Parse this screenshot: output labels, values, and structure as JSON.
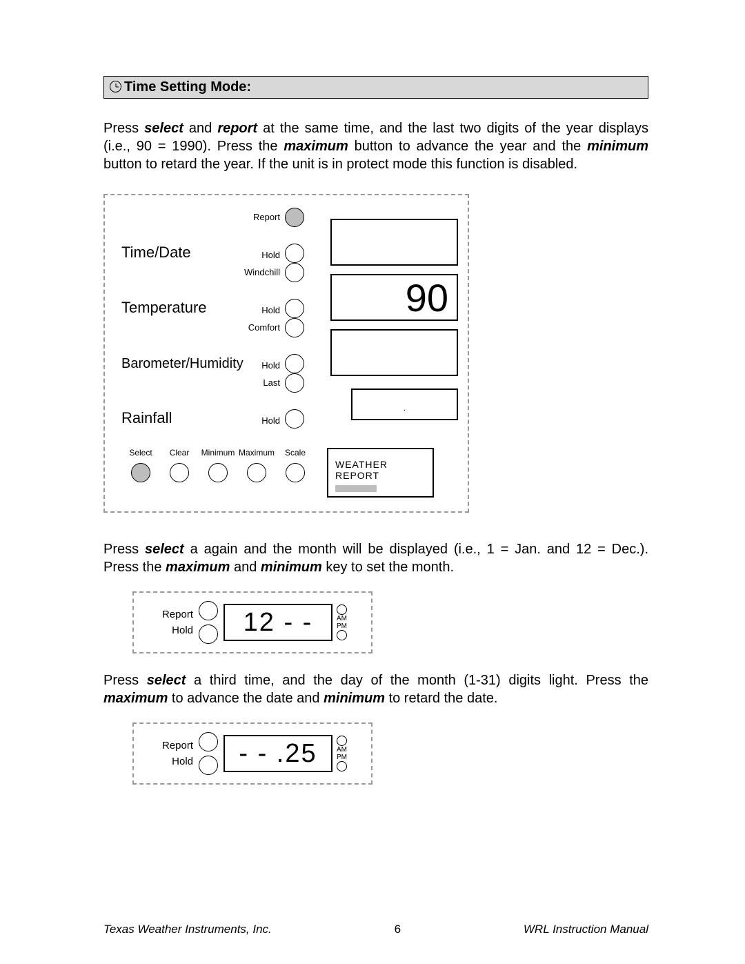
{
  "heading": "Time Setting Mode:",
  "para1": {
    "a": "Press ",
    "b": " and ",
    "c": " at the same time, and the last two digits of the year displays (i.e., 90 = 1990). Press the ",
    "d": " button to advance the year and the ",
    "e": " button to retard the year.  If the unit is in protect mode this function is disabled.",
    "select": "select",
    "report": "report",
    "maximum": "maximum",
    "minimum": "minimum"
  },
  "device": {
    "rows": [
      {
        "title": "Time/Date",
        "topLabel": "Report",
        "botLabel": "Hold",
        "topFilled": true,
        "display": ""
      },
      {
        "title": "Temperature",
        "topLabel": "Windchill",
        "botLabel": "Hold",
        "topFilled": false,
        "display": "90"
      },
      {
        "title": "Barometer/Humidity",
        "topLabel": "Comfort",
        "botLabel": "Hold",
        "topFilled": false,
        "display": ""
      },
      {
        "title": "Rainfall",
        "topLabel": "Last",
        "botLabel": "Hold",
        "topFilled": false,
        "display": "."
      }
    ],
    "bottomButtons": [
      "Select",
      "Clear",
      "Minimum",
      "Maximum",
      "Scale"
    ],
    "bottomFilled": [
      true,
      false,
      false,
      false,
      false
    ],
    "weatherLabel": "WEATHER REPORT"
  },
  "para2": {
    "a": "Press ",
    "b": " a again and the month will be displayed (i.e., 1 = Jan. and 12 = Dec.). Press the ",
    "c": " and ",
    "d": " key to set the month.",
    "select": "select",
    "maximum": "maximum",
    "minimum": "minimum"
  },
  "mini1": {
    "label1": "Report",
    "label2": "Hold",
    "value": "12   -   -",
    "am": "AM",
    "pm": "PM"
  },
  "para3": {
    "a": "Press ",
    "b": " a third time, and the day of the month (1-31) digits light. Press the ",
    "c": " to advance the date and ",
    "d": " to retard the date.",
    "select": "select",
    "maximum": "maximum",
    "minimum": "minimum"
  },
  "mini2": {
    "label1": "Report",
    "label2": "Hold",
    "value": "-   - .25",
    "am": "AM",
    "pm": "PM"
  },
  "footer": {
    "left": "Texas Weather Instruments, Inc.",
    "page": "6",
    "right": "WRL Instruction Manual"
  }
}
